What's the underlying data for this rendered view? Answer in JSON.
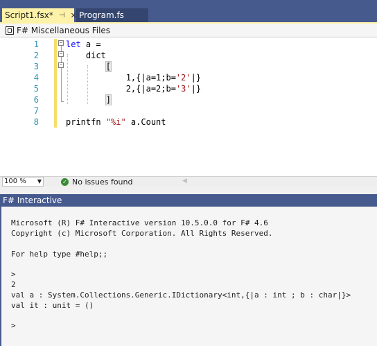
{
  "tabs": [
    {
      "label": "Script1.fsx*",
      "active": true,
      "pin": "⊣",
      "close": "✕"
    },
    {
      "label": "Program.fs",
      "active": false
    }
  ],
  "navbar": {
    "project": "F# Miscellaneous Files"
  },
  "editor": {
    "lines": [
      {
        "n": "1"
      },
      {
        "n": "2"
      },
      {
        "n": "3"
      },
      {
        "n": "4"
      },
      {
        "n": "5"
      },
      {
        "n": "6"
      },
      {
        "n": "7"
      },
      {
        "n": "8"
      }
    ],
    "code": {
      "l1_kw": "let",
      "l1_rest": " a =",
      "l2": "    dict",
      "l3_indent": "        ",
      "l3_bracket": "[",
      "l4_prefix": "            1,{|a=1;b=",
      "l4_str": "'2'",
      "l4_suffix": "|}",
      "l5_prefix": "            2,{|a=2;b=",
      "l5_str": "'3'",
      "l5_suffix": "|}",
      "l6_indent": "        ",
      "l6_bracket": "]",
      "l8_prefix": "printfn ",
      "l8_str": "\"%i\"",
      "l8_suffix": " a.Count"
    }
  },
  "status": {
    "zoom": "100 %",
    "issues": "No issues found"
  },
  "fsi": {
    "title": "F# Interactive",
    "output": [
      "Microsoft (R) F# Interactive version 10.5.0.0 for F# 4.6",
      "Copyright (c) Microsoft Corporation. All Rights Reserved.",
      "",
      "For help type #help;;",
      "",
      ">",
      "2",
      "val a : System.Collections.Generic.IDictionary<int,{|a : int ; b : char|}>",
      "val it : unit = ()",
      "",
      ">"
    ]
  },
  "colors": {
    "tab_active": "#fdf2a8",
    "chrome": "#475a8e",
    "keyword": "#0000ff",
    "string": "#a31515",
    "line_number": "#2b91af"
  }
}
